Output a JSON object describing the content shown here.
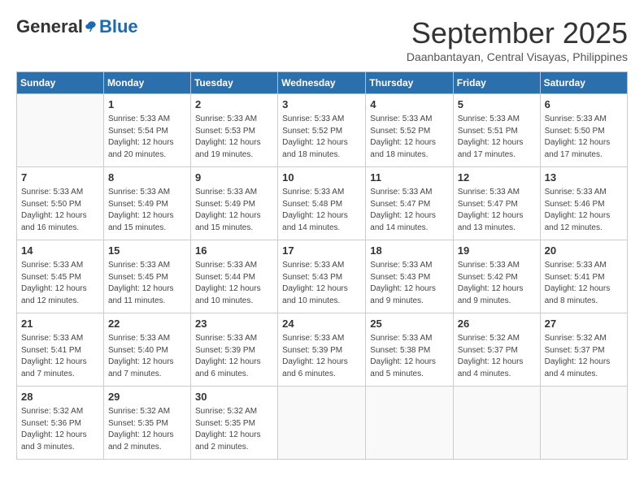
{
  "logo": {
    "general": "General",
    "blue": "Blue"
  },
  "title": {
    "month": "September 2025",
    "location": "Daanbantayan, Central Visayas, Philippines"
  },
  "headers": [
    "Sunday",
    "Monday",
    "Tuesday",
    "Wednesday",
    "Thursday",
    "Friday",
    "Saturday"
  ],
  "weeks": [
    [
      {
        "day": "",
        "info": ""
      },
      {
        "day": "1",
        "info": "Sunrise: 5:33 AM\nSunset: 5:54 PM\nDaylight: 12 hours\nand 20 minutes."
      },
      {
        "day": "2",
        "info": "Sunrise: 5:33 AM\nSunset: 5:53 PM\nDaylight: 12 hours\nand 19 minutes."
      },
      {
        "day": "3",
        "info": "Sunrise: 5:33 AM\nSunset: 5:52 PM\nDaylight: 12 hours\nand 18 minutes."
      },
      {
        "day": "4",
        "info": "Sunrise: 5:33 AM\nSunset: 5:52 PM\nDaylight: 12 hours\nand 18 minutes."
      },
      {
        "day": "5",
        "info": "Sunrise: 5:33 AM\nSunset: 5:51 PM\nDaylight: 12 hours\nand 17 minutes."
      },
      {
        "day": "6",
        "info": "Sunrise: 5:33 AM\nSunset: 5:50 PM\nDaylight: 12 hours\nand 17 minutes."
      }
    ],
    [
      {
        "day": "7",
        "info": "Sunrise: 5:33 AM\nSunset: 5:50 PM\nDaylight: 12 hours\nand 16 minutes."
      },
      {
        "day": "8",
        "info": "Sunrise: 5:33 AM\nSunset: 5:49 PM\nDaylight: 12 hours\nand 15 minutes."
      },
      {
        "day": "9",
        "info": "Sunrise: 5:33 AM\nSunset: 5:49 PM\nDaylight: 12 hours\nand 15 minutes."
      },
      {
        "day": "10",
        "info": "Sunrise: 5:33 AM\nSunset: 5:48 PM\nDaylight: 12 hours\nand 14 minutes."
      },
      {
        "day": "11",
        "info": "Sunrise: 5:33 AM\nSunset: 5:47 PM\nDaylight: 12 hours\nand 14 minutes."
      },
      {
        "day": "12",
        "info": "Sunrise: 5:33 AM\nSunset: 5:47 PM\nDaylight: 12 hours\nand 13 minutes."
      },
      {
        "day": "13",
        "info": "Sunrise: 5:33 AM\nSunset: 5:46 PM\nDaylight: 12 hours\nand 12 minutes."
      }
    ],
    [
      {
        "day": "14",
        "info": "Sunrise: 5:33 AM\nSunset: 5:45 PM\nDaylight: 12 hours\nand 12 minutes."
      },
      {
        "day": "15",
        "info": "Sunrise: 5:33 AM\nSunset: 5:45 PM\nDaylight: 12 hours\nand 11 minutes."
      },
      {
        "day": "16",
        "info": "Sunrise: 5:33 AM\nSunset: 5:44 PM\nDaylight: 12 hours\nand 10 minutes."
      },
      {
        "day": "17",
        "info": "Sunrise: 5:33 AM\nSunset: 5:43 PM\nDaylight: 12 hours\nand 10 minutes."
      },
      {
        "day": "18",
        "info": "Sunrise: 5:33 AM\nSunset: 5:43 PM\nDaylight: 12 hours\nand 9 minutes."
      },
      {
        "day": "19",
        "info": "Sunrise: 5:33 AM\nSunset: 5:42 PM\nDaylight: 12 hours\nand 9 minutes."
      },
      {
        "day": "20",
        "info": "Sunrise: 5:33 AM\nSunset: 5:41 PM\nDaylight: 12 hours\nand 8 minutes."
      }
    ],
    [
      {
        "day": "21",
        "info": "Sunrise: 5:33 AM\nSunset: 5:41 PM\nDaylight: 12 hours\nand 7 minutes."
      },
      {
        "day": "22",
        "info": "Sunrise: 5:33 AM\nSunset: 5:40 PM\nDaylight: 12 hours\nand 7 minutes."
      },
      {
        "day": "23",
        "info": "Sunrise: 5:33 AM\nSunset: 5:39 PM\nDaylight: 12 hours\nand 6 minutes."
      },
      {
        "day": "24",
        "info": "Sunrise: 5:33 AM\nSunset: 5:39 PM\nDaylight: 12 hours\nand 6 minutes."
      },
      {
        "day": "25",
        "info": "Sunrise: 5:33 AM\nSunset: 5:38 PM\nDaylight: 12 hours\nand 5 minutes."
      },
      {
        "day": "26",
        "info": "Sunrise: 5:32 AM\nSunset: 5:37 PM\nDaylight: 12 hours\nand 4 minutes."
      },
      {
        "day": "27",
        "info": "Sunrise: 5:32 AM\nSunset: 5:37 PM\nDaylight: 12 hours\nand 4 minutes."
      }
    ],
    [
      {
        "day": "28",
        "info": "Sunrise: 5:32 AM\nSunset: 5:36 PM\nDaylight: 12 hours\nand 3 minutes."
      },
      {
        "day": "29",
        "info": "Sunrise: 5:32 AM\nSunset: 5:35 PM\nDaylight: 12 hours\nand 2 minutes."
      },
      {
        "day": "30",
        "info": "Sunrise: 5:32 AM\nSunset: 5:35 PM\nDaylight: 12 hours\nand 2 minutes."
      },
      {
        "day": "",
        "info": ""
      },
      {
        "day": "",
        "info": ""
      },
      {
        "day": "",
        "info": ""
      },
      {
        "day": "",
        "info": ""
      }
    ]
  ]
}
